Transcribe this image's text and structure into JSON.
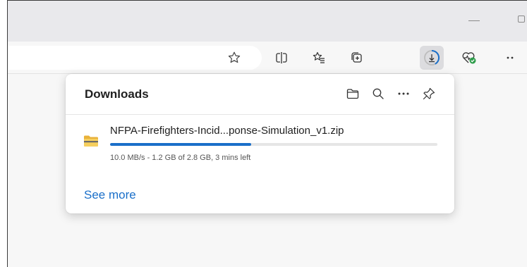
{
  "window": {
    "minimize_icon": "minimize-icon",
    "restore_icon": "restore-icon"
  },
  "toolbar": {
    "favorite_icon": "star-icon",
    "split_screen_icon": "split-screen-icon",
    "favorites_icon": "favorites-list-icon",
    "collections_icon": "collections-icon",
    "downloads_icon": "download-icon",
    "health_icon": "browser-essentials-icon",
    "more_icon": "more-icon"
  },
  "downloads": {
    "title": "Downloads",
    "actions": {
      "open_folder_icon": "folder-icon",
      "search_icon": "search-icon",
      "more_icon": "ellipsis-icon",
      "pin_icon": "pin-icon"
    },
    "items": [
      {
        "file_name": "NFPA-Firefighters-Incid...ponse-Simulation_v1.zip",
        "status": "10.0 MB/s - 1.2 GB of 2.8 GB, 3 mins left",
        "progress_fraction": 0.43,
        "icon": "zip-folder-icon"
      }
    ],
    "see_more_label": "See more"
  },
  "colors": {
    "accent": "#1a6fc9",
    "progress_track": "#e6e6e6",
    "folder_yellow": "#f2c447"
  }
}
